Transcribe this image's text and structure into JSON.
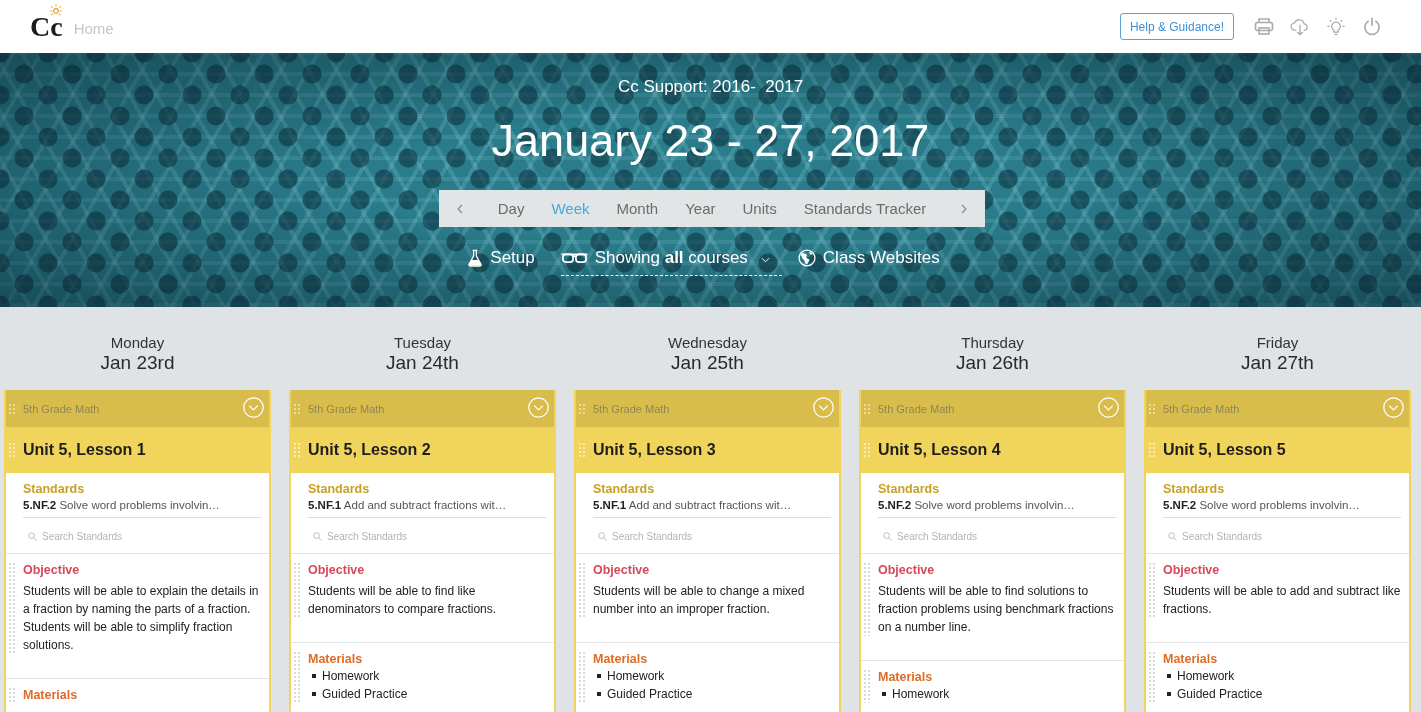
{
  "top_bar": {
    "logo": "Cc",
    "home_link": "Home",
    "help_button": "Help & Guidance!"
  },
  "header": {
    "subtitle": "Cc Support: 2016-  2017",
    "title": "January 23 - 27, 2017",
    "view_tabs": [
      {
        "label": "Day",
        "selected": false
      },
      {
        "label": "Week",
        "selected": true
      },
      {
        "label": "Month",
        "selected": false
      },
      {
        "label": "Year",
        "selected": false
      },
      {
        "label": "Units",
        "selected": false
      },
      {
        "label": "Standards Tracker",
        "selected": false
      }
    ],
    "actions": [
      {
        "kind": "setup",
        "label": "Setup"
      },
      {
        "kind": "filter",
        "label": "Showing **all** courses"
      },
      {
        "kind": "websites",
        "label": "Class Websites"
      }
    ]
  },
  "days": [
    {
      "weekday": "Monday",
      "date": "Jan 23rd",
      "card": {
        "course": "5th Grade Math",
        "title": "Unit 5, Lesson 1",
        "sections": [
          {
            "kind": "standards",
            "heading": "Standards",
            "items": [
              "**5.NF.2** Solve word problems involvin…"
            ],
            "placeholder": "Search Standards"
          },
          {
            "kind": "objective",
            "heading": "Objective",
            "text": "Students will be able to explain the details in a fraction by naming the parts of a fraction. Students will be able to simplify fraction solutions."
          },
          {
            "kind": "materials",
            "heading": "Materials"
          }
        ]
      }
    },
    {
      "weekday": "Tuesday",
      "date": "Jan 24th",
      "card": {
        "course": "5th Grade Math",
        "title": "Unit 5, Lesson 2",
        "sections": [
          {
            "kind": "standards",
            "heading": "Standards",
            "items": [
              "**5.NF.1** Add and subtract fractions wit…"
            ],
            "placeholder": "Search Standards"
          },
          {
            "kind": "objective",
            "heading": "Objective",
            "text": "Students will be able to find like denominators to compare fractions."
          },
          {
            "kind": "materials",
            "heading": "Materials",
            "items": [
              "Homework",
              "Guided Practice"
            ]
          }
        ]
      }
    },
    {
      "weekday": "Wednesday",
      "date": "Jan 25th",
      "card": {
        "course": "5th Grade Math",
        "title": "Unit 5, Lesson 3",
        "sections": [
          {
            "kind": "standards",
            "heading": "Standards",
            "items": [
              "**5.NF.1** Add and subtract fractions wit…"
            ],
            "placeholder": "Search Standards"
          },
          {
            "kind": "objective",
            "heading": "Objective",
            "text": "Students will be able to change a mixed number into an improper fraction."
          },
          {
            "kind": "materials",
            "heading": "Materials",
            "items": [
              "Homework",
              "Guided Practice"
            ]
          }
        ]
      }
    },
    {
      "weekday": "Thursday",
      "date": "Jan 26th",
      "card": {
        "course": "5th Grade Math",
        "title": "Unit 5, Lesson 4",
        "sections": [
          {
            "kind": "standards",
            "heading": "Standards",
            "items": [
              "**5.NF.2** Solve word problems involvin…"
            ],
            "placeholder": "Search Standards"
          },
          {
            "kind": "objective",
            "heading": "Objective",
            "text": "Students will be able to find solutions to fraction problems using benchmark fractions on a number line."
          },
          {
            "kind": "materials",
            "heading": "Materials",
            "items": [
              "Homework"
            ]
          }
        ]
      }
    },
    {
      "weekday": "Friday",
      "date": "Jan 27th",
      "card": {
        "course": "5th Grade Math",
        "title": "Unit 5, Lesson 5",
        "sections": [
          {
            "kind": "standards",
            "heading": "Standards",
            "items": [
              "**5.NF.2** Solve word problems involvin…"
            ],
            "placeholder": "Search Standards"
          },
          {
            "kind": "objective",
            "heading": "Objective",
            "text": "Students will be able to add and subtract like fractions."
          },
          {
            "kind": "materials",
            "heading": "Materials",
            "items": [
              "Homework",
              "Guided Practice"
            ]
          }
        ]
      }
    }
  ]
}
